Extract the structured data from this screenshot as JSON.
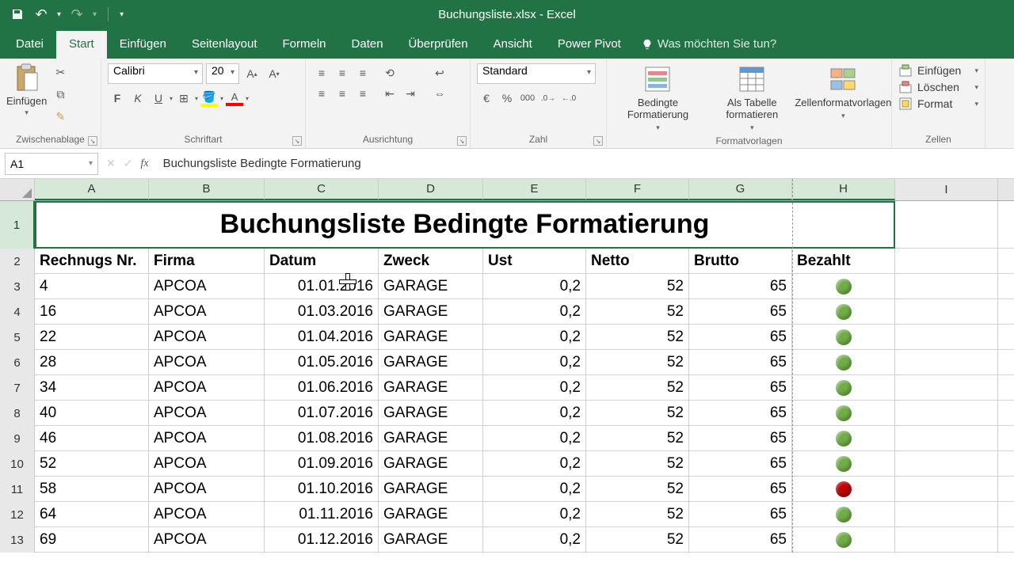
{
  "titlebar": {
    "filename": "Buchungsliste.xlsx - Excel"
  },
  "tabs": {
    "file": "Datei",
    "list": [
      "Start",
      "Einfügen",
      "Seitenlayout",
      "Formeln",
      "Daten",
      "Überprüfen",
      "Ansicht",
      "Power Pivot"
    ],
    "active": "Start",
    "tell_me": "Was möchten Sie tun?"
  },
  "ribbon": {
    "clipboard": {
      "paste": "Einfügen",
      "label": "Zwischenablage"
    },
    "font": {
      "family": "Calibri",
      "size": "20",
      "label": "Schriftart"
    },
    "alignment": {
      "label": "Ausrichtung"
    },
    "number": {
      "format": "Standard",
      "label": "Zahl"
    },
    "styles": {
      "cond": "Bedingte Formatierung",
      "table": "Als Tabelle formatieren",
      "cell": "Zellenformatvorlagen",
      "label": "Formatvorlagen"
    },
    "cells": {
      "insert": "Einfügen",
      "delete": "Löschen",
      "format": "Format",
      "label": "Zellen"
    }
  },
  "namebox": "A1",
  "formula": "Buchungsliste Bedingte Formatierung",
  "columns": {
    "letters": [
      "A",
      "B",
      "C",
      "D",
      "E",
      "F",
      "G",
      "H",
      "I"
    ],
    "widths": [
      144,
      146,
      144,
      132,
      130,
      130,
      130,
      130,
      130
    ]
  },
  "title_row": "Buchungsliste Bedingte Formatierung",
  "headers": [
    "Rechnugs Nr.",
    "Firma",
    "Datum",
    "Zweck",
    "Ust",
    "Netto",
    "Brutto",
    "Bezahlt"
  ],
  "rows": [
    {
      "n": "3",
      "nr": "4",
      "firma": "APCOA",
      "datum": "01.01.2016",
      "zweck": "GARAGE",
      "ust": "0,2",
      "netto": "52",
      "brutto": "65",
      "paid": "green"
    },
    {
      "n": "4",
      "nr": "16",
      "firma": "APCOA",
      "datum": "01.03.2016",
      "zweck": "GARAGE",
      "ust": "0,2",
      "netto": "52",
      "brutto": "65",
      "paid": "green"
    },
    {
      "n": "5",
      "nr": "22",
      "firma": "APCOA",
      "datum": "01.04.2016",
      "zweck": "GARAGE",
      "ust": "0,2",
      "netto": "52",
      "brutto": "65",
      "paid": "green"
    },
    {
      "n": "6",
      "nr": "28",
      "firma": "APCOA",
      "datum": "01.05.2016",
      "zweck": "GARAGE",
      "ust": "0,2",
      "netto": "52",
      "brutto": "65",
      "paid": "green"
    },
    {
      "n": "7",
      "nr": "34",
      "firma": "APCOA",
      "datum": "01.06.2016",
      "zweck": "GARAGE",
      "ust": "0,2",
      "netto": "52",
      "brutto": "65",
      "paid": "green"
    },
    {
      "n": "8",
      "nr": "40",
      "firma": "APCOA",
      "datum": "01.07.2016",
      "zweck": "GARAGE",
      "ust": "0,2",
      "netto": "52",
      "brutto": "65",
      "paid": "green"
    },
    {
      "n": "9",
      "nr": "46",
      "firma": "APCOA",
      "datum": "01.08.2016",
      "zweck": "GARAGE",
      "ust": "0,2",
      "netto": "52",
      "brutto": "65",
      "paid": "green"
    },
    {
      "n": "10",
      "nr": "52",
      "firma": "APCOA",
      "datum": "01.09.2016",
      "zweck": "GARAGE",
      "ust": "0,2",
      "netto": "52",
      "brutto": "65",
      "paid": "green"
    },
    {
      "n": "11",
      "nr": "58",
      "firma": "APCOA",
      "datum": "01.10.2016",
      "zweck": "GARAGE",
      "ust": "0,2",
      "netto": "52",
      "brutto": "65",
      "paid": "red"
    },
    {
      "n": "12",
      "nr": "64",
      "firma": "APCOA",
      "datum": "01.11.2016",
      "zweck": "GARAGE",
      "ust": "0,2",
      "netto": "52",
      "brutto": "65",
      "paid": "green"
    },
    {
      "n": "13",
      "nr": "69",
      "firma": "APCOA",
      "datum": "01.12.2016",
      "zweck": "GARAGE",
      "ust": "0,2",
      "netto": "52",
      "brutto": "65",
      "paid": "green"
    }
  ]
}
